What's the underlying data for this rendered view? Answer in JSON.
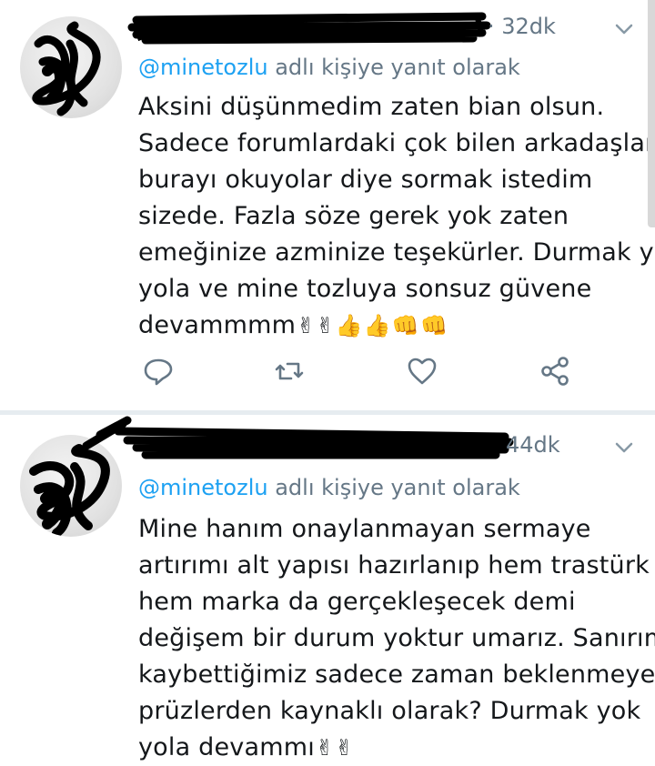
{
  "tweets": [
    {
      "timestamp": "32dk",
      "reply_prefix": "@minetozlu",
      "reply_suffix": " adlı kişiye yanıt olarak",
      "body_lines": [
        "Aksini düşünmedim zaten bian olsun.",
        "Sadece forumlardaki çok bilen arkadaşlar",
        "burayı okuyolar diye sormak istedim",
        "sizede. Fazla söze gerek yok zaten",
        "emeğinize azminize teşekürler. Durmak yok",
        "yola ve mine tozluya sonsuz güvene",
        "devammmm"
      ],
      "emojis": [
        "✌",
        "✌",
        "👍",
        "👍",
        "👊",
        "👊"
      ],
      "actions": {
        "reply_icon": "reply-icon",
        "retweet_icon": "retweet-icon",
        "like_icon": "heart-icon",
        "share_icon": "share-icon"
      }
    },
    {
      "timestamp": "44dk",
      "reply_prefix": "@minetozlu",
      "reply_suffix": " adlı kişiye yanıt olarak",
      "body_lines": [
        "Mine hanım onaylanmayan sermaye",
        "artırımı alt yapısı hazırlanıp hem trastürk",
        "hem marka da gerçekleşecek demi",
        "değişem bir durum yoktur umarız. Sanırım",
        "kaybettiğimiz sadece zaman beklenmeyen",
        "prüzlerden kaynaklı olarak? Durmak yok",
        "yola devammı"
      ],
      "emojis": [
        "✌",
        "✌"
      ]
    }
  ],
  "colors": {
    "link": "#1da1f2",
    "secondary_text": "#657786",
    "primary_text": "#14171a",
    "separator": "#e6ecf0",
    "redaction": "#000000"
  }
}
